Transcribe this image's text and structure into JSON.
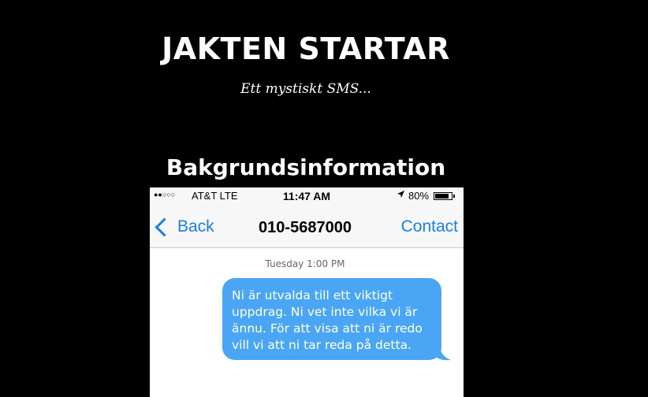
{
  "header": {
    "title": "JAKTEN STARTAR",
    "subtitle": "Ett mystiskt SMS..."
  },
  "section": {
    "heading": "Bakgrundsinformation"
  },
  "phone": {
    "status_bar": {
      "signal": "●●○○○",
      "carrier": "AT&T LTE",
      "time": "11:47 AM",
      "location_icon": "location-arrow-icon",
      "battery": "80%"
    },
    "nav": {
      "back_label": "Back",
      "title": "010-5687000",
      "contact_label": "Contact"
    },
    "timestamp": "Tuesday 1:00 PM",
    "message": "Ni är utvalda till ett viktigt uppdrag. Ni vet inte vilka vi är ännu. För att visa att ni är redo vill vi att ni tar reda på detta.",
    "colors": {
      "accent": "#1a7fe3",
      "bubble": "#4aa6f5"
    }
  }
}
